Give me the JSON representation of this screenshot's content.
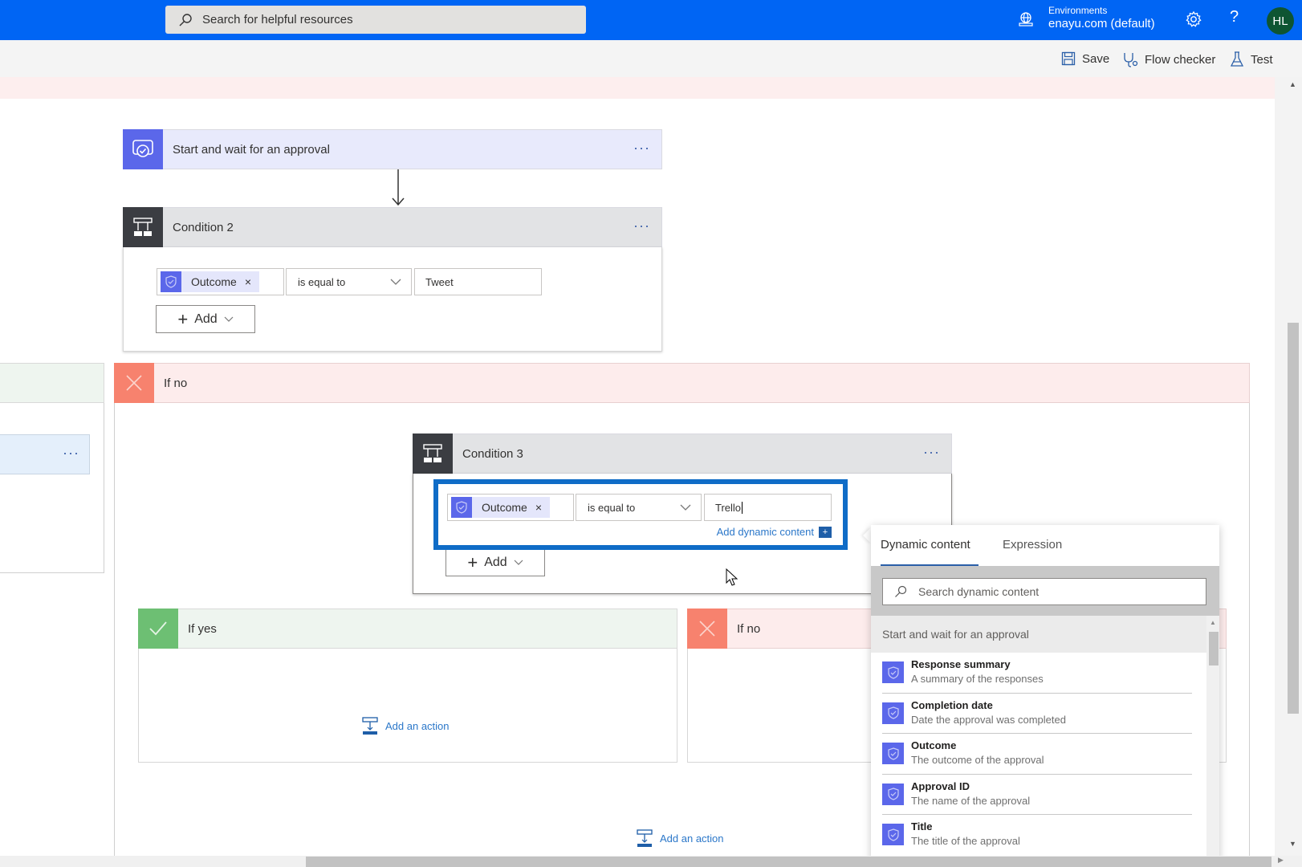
{
  "topbar": {
    "search_placeholder": "Search for helpful resources",
    "environment_label": "Environments",
    "environment_value": "enayu.com (default)",
    "help_glyph": "?",
    "avatar_initials": "HL",
    "brand_color": "#0065f4",
    "avatar_color": "#0e5532"
  },
  "commandbar": {
    "save": "Save",
    "flow_checker": "Flow checker",
    "test": "Test"
  },
  "canvas": {
    "approval_step": {
      "title": "Start and wait for an approval",
      "more": "···"
    },
    "condition2": {
      "title": "Condition 2",
      "more": "···",
      "token": "Outcome",
      "token_remove": "×",
      "operator": "is equal to",
      "value": "Tweet",
      "add_label": "Add"
    },
    "left_branch_card": {
      "more": "···"
    },
    "outer_if_no": {
      "label": "If no"
    },
    "condition3": {
      "title": "Condition 3",
      "more": "···",
      "token": "Outcome",
      "token_remove": "×",
      "operator": "is equal to",
      "value": "Trello",
      "add_dynamic_content": "Add dynamic content",
      "add_dynamic_icon": "+",
      "add_label": "Add"
    },
    "if_yes": {
      "label": "If yes",
      "add_action": "Add an action"
    },
    "if_no": {
      "label": "If no"
    },
    "bottom_add_action": "Add an action"
  },
  "dynamic_panel": {
    "tabs": [
      {
        "label": "Dynamic content",
        "active": true
      },
      {
        "label": "Expression",
        "active": false
      }
    ],
    "search_placeholder": "Search dynamic content",
    "group_title": "Start and wait for an approval",
    "items": [
      {
        "name": "Response summary",
        "description": "A summary of the responses"
      },
      {
        "name": "Completion date",
        "description": "Date the approval was completed"
      },
      {
        "name": "Outcome",
        "description": "The outcome of the approval"
      },
      {
        "name": "Approval ID",
        "description": "The name of the approval"
      },
      {
        "name": "Title",
        "description": "The title of the approval"
      }
    ]
  },
  "colors": {
    "approval_icon": "#5b67ea",
    "condition_icon": "#3b3d42",
    "yes_green": "#6dbf73",
    "no_red": "#f7826e",
    "focus_border": "#0f6cc7",
    "link_blue": "#2b77c9"
  }
}
